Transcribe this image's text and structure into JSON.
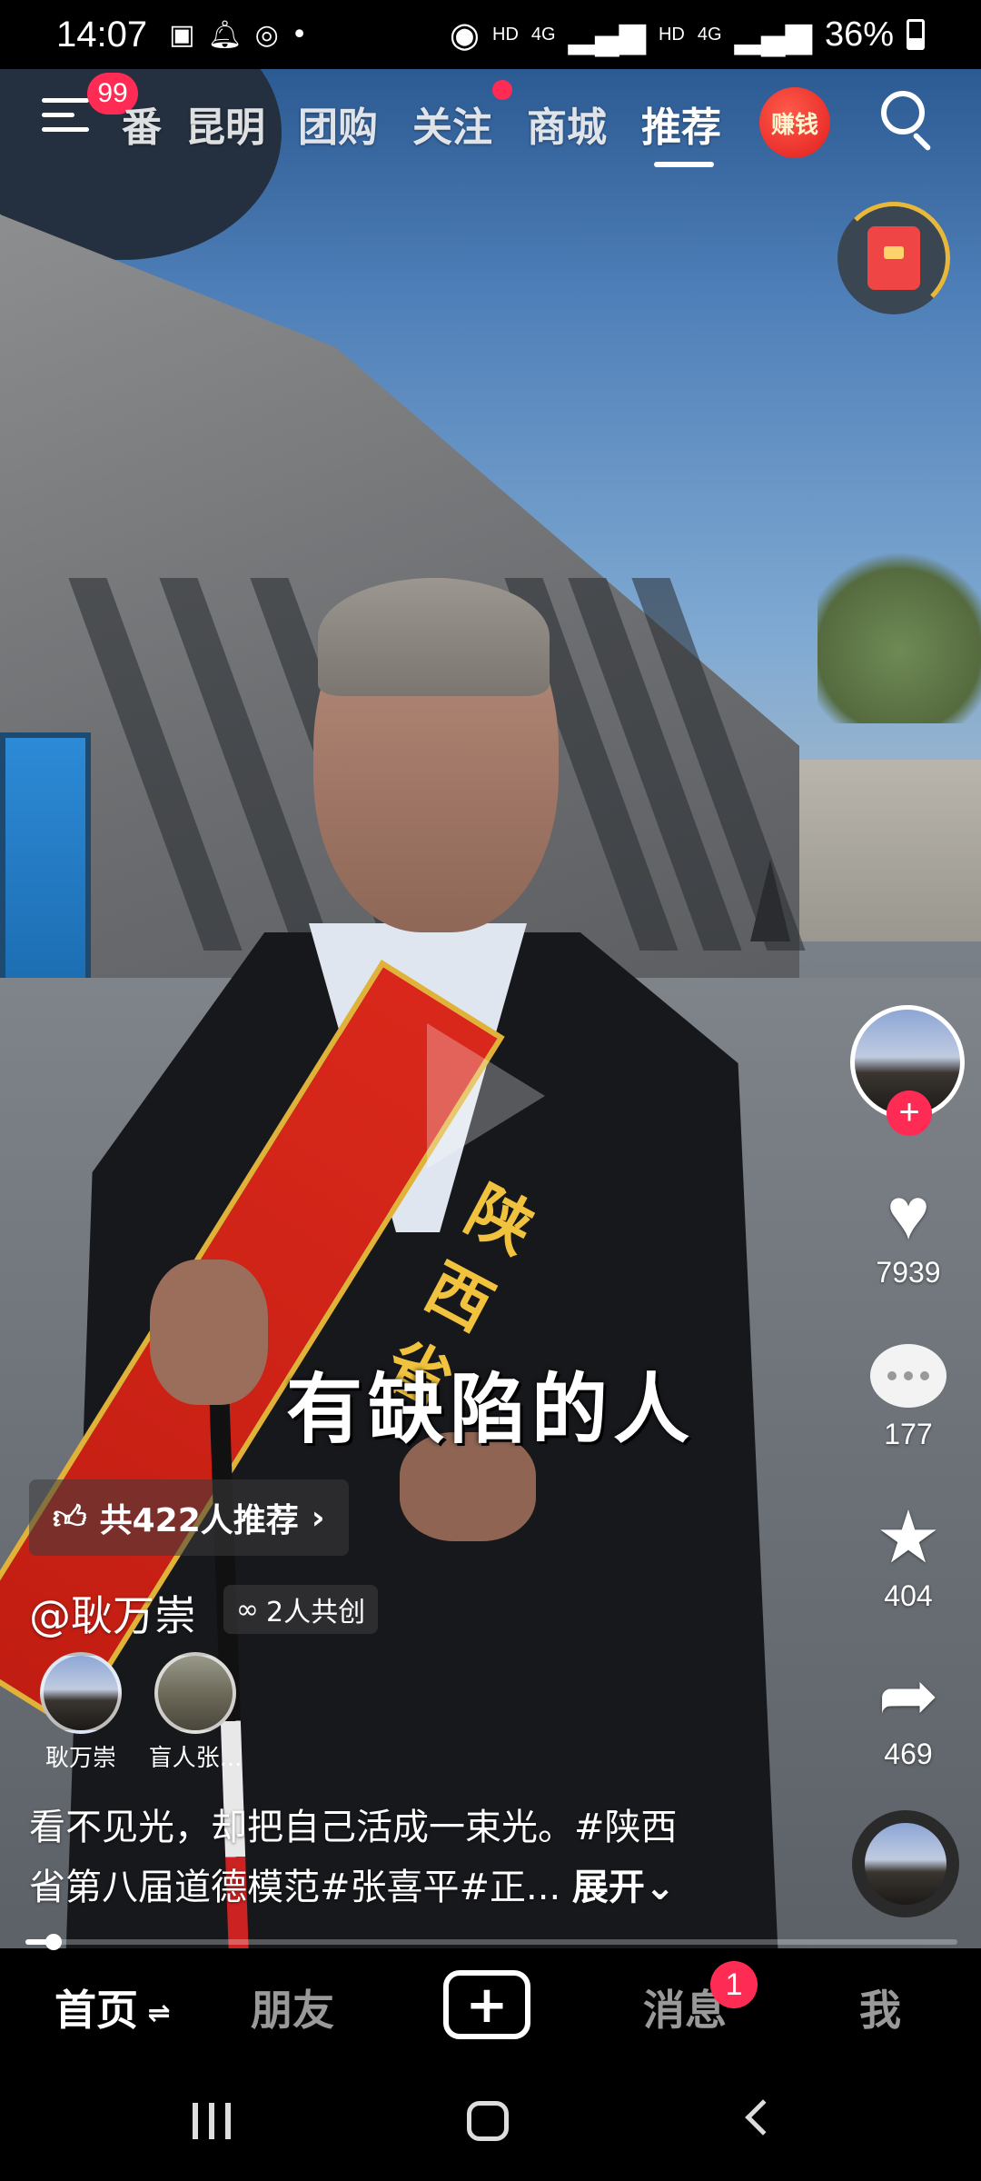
{
  "status_bar": {
    "time": "14:07",
    "network_labels": [
      "HD",
      "4G",
      "HD",
      "4G"
    ],
    "battery": "36%",
    "icons": [
      "gallery-icon",
      "alarm-bell-icon",
      "wechat-icon",
      "dot-icon",
      "hotspot-icon",
      "signal-icon",
      "signal-icon",
      "battery-icon"
    ]
  },
  "top_nav": {
    "menu_badge": "99",
    "tabs": [
      {
        "label": "番",
        "active": false
      },
      {
        "label": "昆明",
        "active": false
      },
      {
        "label": "团购",
        "active": false
      },
      {
        "label": "关注",
        "active": false
      },
      {
        "label": "商城",
        "active": false
      },
      {
        "label": "推荐",
        "active": true
      }
    ],
    "earn_label": "赚钱"
  },
  "video": {
    "subtitle": "有缺陷的人",
    "sash_text": "陕西省"
  },
  "actions": {
    "likes": "7939",
    "comments": "177",
    "favorites": "404",
    "shares": "469"
  },
  "info": {
    "recommend_text": "共422人推荐",
    "author": "@耿万崇",
    "cocreate_label": "2人共创",
    "cocreators": [
      {
        "name": "耿万崇"
      },
      {
        "name": "盲人张..."
      }
    ],
    "description_line1": "看不见光，却把自己活成一束光。#陕西",
    "description_line2": "省第八届道德模范#张喜平#正...",
    "expand_label": "展开",
    "progress": 0.03
  },
  "tab_bar": {
    "home": "首页",
    "friends": "朋友",
    "create": "+",
    "messages": "消息",
    "messages_badge": "1",
    "me": "我"
  },
  "colors": {
    "accent": "#fe2c55",
    "gold": "#e0b338",
    "sash_red": "#c21d12"
  }
}
